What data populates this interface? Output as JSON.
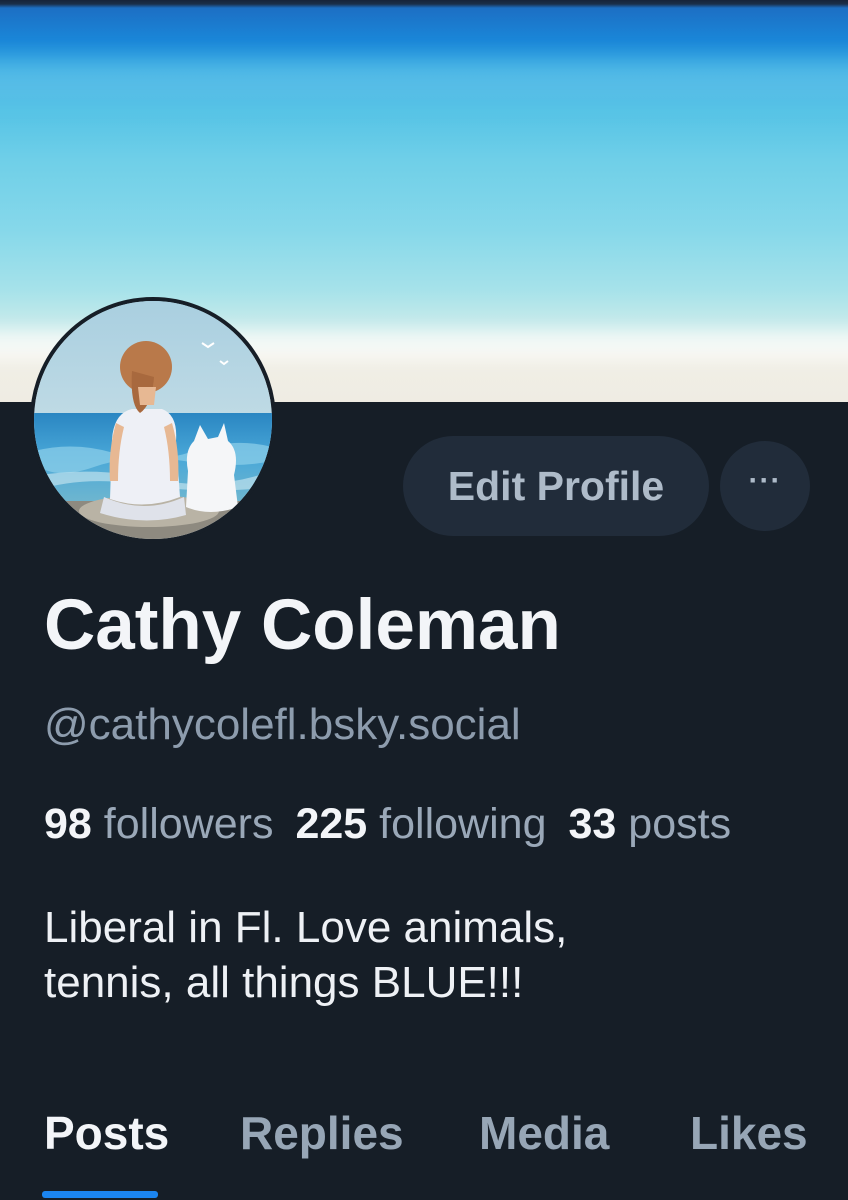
{
  "profile": {
    "display_name": "Cathy Coleman",
    "handle": "@cathycolefl.bsky.social",
    "bio_lines": [
      "Liberal in Fl. Love animals,",
      "tennis, all things BLUE!!!"
    ]
  },
  "stats": {
    "followers_count": "98",
    "followers_label": "followers",
    "following_count": "225",
    "following_label": "following",
    "posts_count": "33",
    "posts_label": "posts"
  },
  "actions": {
    "edit_profile_label": "Edit Profile",
    "more_label": "···"
  },
  "tabs": [
    {
      "label": "Posts",
      "active": true
    },
    {
      "label": "Replies",
      "active": false
    },
    {
      "label": "Media",
      "active": false
    },
    {
      "label": "Likes",
      "active": false
    }
  ],
  "colors": {
    "background": "#161e27",
    "button_bg": "#212c3a",
    "accent": "#1b85f0",
    "text_primary": "#f3f5f8",
    "text_secondary": "#8d9cad"
  },
  "icons": {
    "more": "ellipsis-icon"
  }
}
